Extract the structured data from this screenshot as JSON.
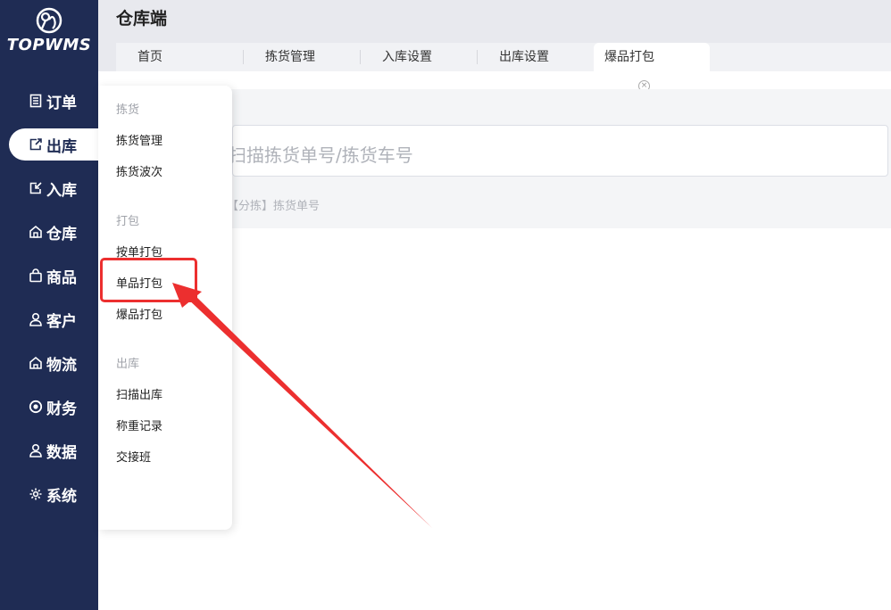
{
  "logo": {
    "text": "TOPWMS"
  },
  "nav": [
    {
      "label": "订单",
      "icon": "document-icon"
    },
    {
      "label": "出库",
      "icon": "export-icon",
      "active": true
    },
    {
      "label": "入库",
      "icon": "import-icon"
    },
    {
      "label": "仓库",
      "icon": "warehouse-icon"
    },
    {
      "label": "商品",
      "icon": "bag-icon"
    },
    {
      "label": "客户",
      "icon": "user-icon"
    },
    {
      "label": "物流",
      "icon": "logistics-icon"
    },
    {
      "label": "财务",
      "icon": "finance-icon"
    },
    {
      "label": "数据",
      "icon": "data-icon"
    },
    {
      "label": "系统",
      "icon": "gear-icon"
    }
  ],
  "header": {
    "title": "仓库端"
  },
  "tabs": [
    {
      "label": "首页"
    },
    {
      "label": "拣货管理"
    },
    {
      "label": "入库设置"
    },
    {
      "label": "出库设置"
    },
    {
      "label": "爆品打包",
      "active": true
    }
  ],
  "main": {
    "scan_placeholder": "扫描拣货单号/拣货车号",
    "hint": "【分拣】拣货单号"
  },
  "dropdown": {
    "groups": [
      {
        "title": "拣货",
        "items": [
          "拣货管理",
          "拣货波次"
        ]
      },
      {
        "title": "打包",
        "items": [
          "按单打包",
          "单品打包",
          "爆品打包"
        ]
      },
      {
        "title": "出库",
        "items": [
          "扫描出库",
          "称重记录",
          "交接班"
        ]
      }
    ]
  },
  "colors": {
    "sidebar": "#1f2c54",
    "highlight": "#ec2f2f"
  }
}
